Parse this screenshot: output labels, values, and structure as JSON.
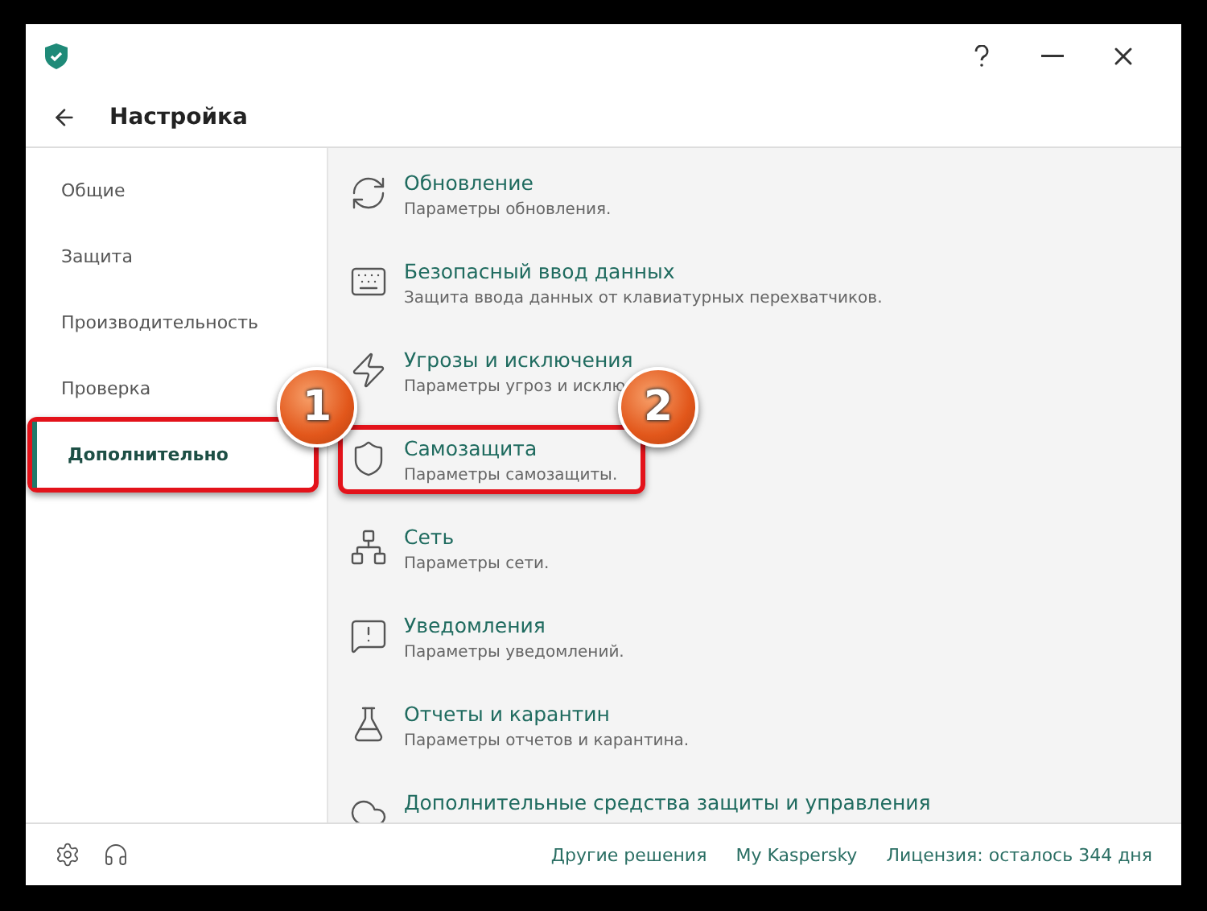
{
  "window": {
    "title": "Настройка"
  },
  "sidebar": {
    "items": [
      {
        "label": "Общие",
        "selected": false,
        "highlighted": false
      },
      {
        "label": "Защита",
        "selected": false,
        "highlighted": false
      },
      {
        "label": "Производительность",
        "selected": false,
        "highlighted": false
      },
      {
        "label": "Проверка",
        "selected": false,
        "highlighted": false
      },
      {
        "label": "Дополнительно",
        "selected": true,
        "highlighted": true,
        "badge": "1"
      }
    ]
  },
  "sections": [
    {
      "title": "Обновление",
      "description": "Параметры обновления.",
      "highlighted": false
    },
    {
      "title": "Безопасный ввод данных",
      "description": "Защита ввода данных от клавиатурных перехватчиков.",
      "highlighted": false
    },
    {
      "title": "Угрозы и исключения",
      "description": "Параметры угроз и исклю",
      "highlighted": false
    },
    {
      "title": "Самозащита",
      "description": "Параметры самозащиты.",
      "highlighted": true,
      "badge": "2"
    },
    {
      "title": "Сеть",
      "description": "Параметры сети.",
      "highlighted": false
    },
    {
      "title": "Уведомления",
      "description": "Параметры уведомлений.",
      "highlighted": false
    },
    {
      "title": "Отчеты и карантин",
      "description": "Параметры отчетов и карантина.",
      "highlighted": false
    },
    {
      "title": "Дополнительные средства защиты и управления",
      "highlighted": false
    }
  ],
  "footer": {
    "links": [
      "Другие решения",
      "My Kaspersky",
      "Лицензия: осталось 344 дня"
    ]
  }
}
